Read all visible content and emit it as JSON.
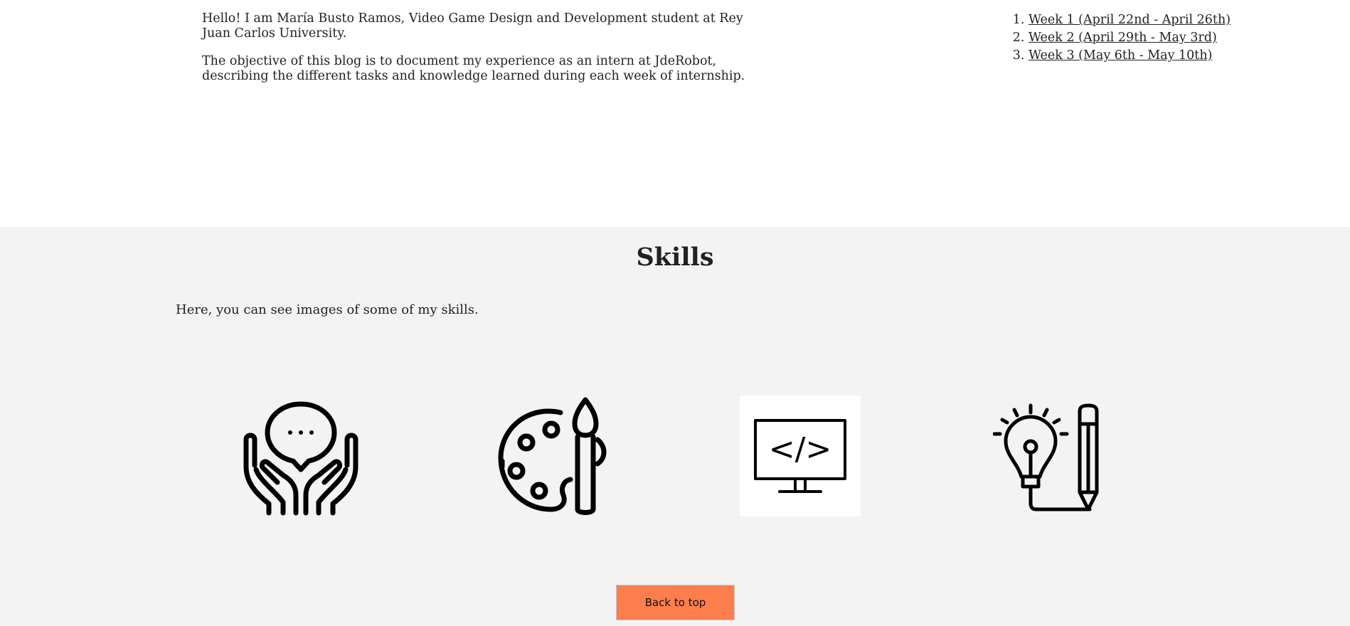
{
  "intro": {
    "paragraph1": "Hello! I am María Busto Ramos, Video Game Design and Development student at Rey Juan Carlos University.",
    "paragraph2": "The objective of this blog is to document my experience as an intern at JdeRobot, describing the different tasks and knowledge learned during each week of internship."
  },
  "weeks": [
    {
      "label": "Week 1 (April 22nd - April 26th)"
    },
    {
      "label": "Week 2 (April 29th - May 3rd)"
    },
    {
      "label": "Week 3 (May 6th - May 10th)"
    }
  ],
  "skills": {
    "title": "Skills",
    "description": "Here, you can see images of some of my skills.",
    "icons": [
      "communication-icon",
      "art-palette-icon",
      "code-monitor-icon",
      "creativity-icon"
    ],
    "code_glyph": "</>"
  },
  "back_to_top": {
    "label": "Back to top"
  },
  "colors": {
    "button": "#fe7e4e",
    "section_bg": "#f3f3f3",
    "text": "#222222"
  }
}
